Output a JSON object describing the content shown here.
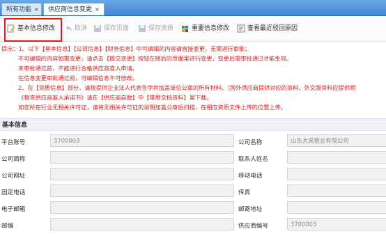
{
  "tabs": [
    {
      "label": "所有功能",
      "close": "×"
    },
    {
      "label": "供应商信息变更",
      "close": "×"
    }
  ],
  "toolbar": {
    "items": [
      {
        "label": "基本信息修改",
        "icon": "edit-doc-icon",
        "disabled": false
      },
      {
        "label": "取消",
        "icon": "undo-icon",
        "disabled": true
      },
      {
        "label": "保存页面",
        "icon": "save-icon",
        "disabled": true
      },
      {
        "label": "保存资质",
        "icon": "save-icon",
        "disabled": true
      },
      {
        "label": "重要信息修改",
        "icon": "important-edit-icon",
        "disabled": false
      },
      {
        "label": "查看最近驳回原因",
        "icon": "view-reason-icon",
        "disabled": false
      }
    ]
  },
  "notice": {
    "lines": [
      "提示：1、以下【基本信息】【公司信息】【财务信息】中可编辑的内容请直接变更，无需进行审批；",
      "不可编辑的内容如需变更，请点击【提交变更】按钮在随后的页面里进行变更，变更后需审批通过才能生效。",
      "未审批通过前，不能进行合格供应商准入申请。",
      "在信息变更审批通过前，可编辑信息不可修改。",
      "2、在【资质信息】部分，请按提供企业法人代表签字并加盖单位公章的所有材料。（国外供应商提供对应的资料，外文版资料应提供相",
      "《物资供应商准入承诺书》请在【供应商自助】中【常用文档资料】里下载。",
      "如您所在行业无相关许可证，请将无相关许可证的说明加盖公章后扫描，在相应资质文件上传的位置上传。"
    ]
  },
  "section": {
    "title": "基本信息"
  },
  "form": {
    "rows": [
      {
        "left_label": "平台账号",
        "left_value": "3700003",
        "right_label": "公司名称",
        "right_value": "山东大禹管业有限公司"
      },
      {
        "left_label": "公司简称",
        "left_value": "",
        "right_label": "联系人姓名",
        "right_value": ""
      },
      {
        "left_label": "公司网址",
        "left_value": "",
        "right_label": "移动电话",
        "right_value": ""
      },
      {
        "left_label": "固定电话",
        "left_value": "",
        "right_label": "传真",
        "right_value": ""
      },
      {
        "left_label": "电子邮箱",
        "left_value": "",
        "right_label": "邮寄地址",
        "right_value": ""
      },
      {
        "left_label": "邮编",
        "left_value": "",
        "right_label": "供应商编号",
        "right_value": "3700003"
      }
    ]
  },
  "colors": {
    "notice": "#e02020",
    "tabbar": "#4a8fd8",
    "highlight": "#e01818"
  }
}
